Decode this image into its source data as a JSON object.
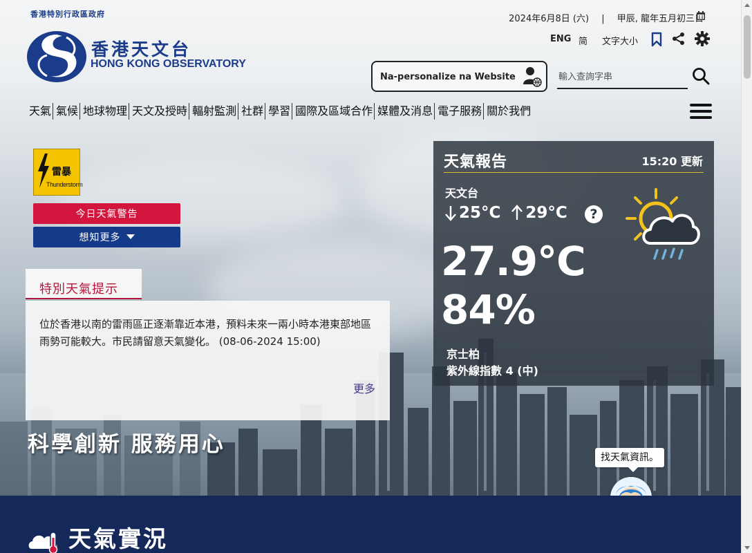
{
  "header": {
    "gov_title": "香港特別行政區政府",
    "org_name_cn": "香港天文台",
    "org_name_en": "HONG KONG OBSERVATORY",
    "date": "2024年6月8日 (六)",
    "separator": "|",
    "lunar_date": "甲辰, 龍年五月初三日",
    "lang_en": "ENG",
    "lang_simplified": "简",
    "font_size": "文字大小",
    "personalize_label": "Na-personalize na Website",
    "search_placeholder": "輸入查詢字串"
  },
  "nav": {
    "items": [
      "天氣",
      "氣候",
      "地球物理",
      "天文及授時",
      "輻射監測",
      "社群",
      "學習",
      "國際及區域合作",
      "媒體及消息",
      "電子服務",
      "關於我們"
    ]
  },
  "warning": {
    "icon_text": "雷暴",
    "icon_sub": "Thunderstorm",
    "today_button": "今日天氣警告",
    "more_button": "想知更多"
  },
  "special_tip": {
    "tab_label": "特別天氣提示",
    "text": "位於香港以南的雷雨區正逐漸靠近本港，預料未來一兩小時本港東部地區雨勢可能較大。市民請留意天氣變化。 (08-06-2024 15:00)",
    "more_link": "更多"
  },
  "slogan": "科學創新 服務用心",
  "weather": {
    "title": "天氣報告",
    "updated": "15:20 更新",
    "station": "天文台",
    "min_temp": "25°C",
    "max_temp": "29°C",
    "help": "?",
    "temperature": "27.9°C",
    "humidity": "84%",
    "uv_station": "京士柏",
    "uv_index": "紫外線指數 4 (中)"
  },
  "chat": {
    "bubble": "找天氣資訊。"
  },
  "section": {
    "title": "天氣實況"
  },
  "colors": {
    "brand_blue": "#1b3c8a",
    "warning_red": "#d3163e",
    "accent_gold": "#e1b82b",
    "panel_dark": "#2c343e",
    "bottom_navy": "#14285a"
  }
}
